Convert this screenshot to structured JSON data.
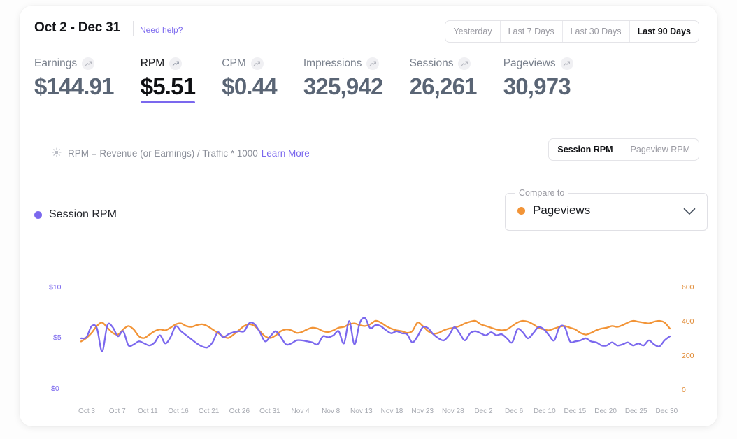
{
  "header": {
    "date_range": "Oct 2 - Dec 31",
    "need_help": "Need help?",
    "range_buttons": [
      {
        "label": "Yesterday",
        "active": false
      },
      {
        "label": "Last 7 Days",
        "active": false
      },
      {
        "label": "Last 30 Days",
        "active": false
      },
      {
        "label": "Last 90 Days",
        "active": true
      }
    ]
  },
  "metrics": [
    {
      "label": "Earnings",
      "value": "$144.91",
      "active": false,
      "icon": "trend-up-icon"
    },
    {
      "label": "RPM",
      "value": "$5.51",
      "active": true,
      "icon": "trend-up-icon"
    },
    {
      "label": "CPM",
      "value": "$0.44",
      "active": false,
      "icon": "trend-up-icon"
    },
    {
      "label": "Impressions",
      "value": "325,942",
      "active": false,
      "icon": "trend-up-icon"
    },
    {
      "label": "Sessions",
      "value": "26,261",
      "active": false,
      "icon": "trend-up-icon"
    },
    {
      "label": "Pageviews",
      "value": "30,973",
      "active": false,
      "icon": "trend-up-icon"
    }
  ],
  "formula": {
    "icon": "lightbulb-icon",
    "text": "RPM = Revenue (or Earnings) / Traffic * 1000",
    "learn_more": "Learn More"
  },
  "rpm_toggle": [
    {
      "label": "Session RPM",
      "active": true
    },
    {
      "label": "Pageview RPM",
      "active": false
    }
  ],
  "legend": {
    "primary_label": "Session RPM",
    "primary_color": "#7b68ee"
  },
  "compare": {
    "legend_label": "Compare to",
    "selected": "Pageviews",
    "selected_color": "#f29437",
    "chevron": "chevron-down-icon"
  },
  "chart_data": {
    "type": "line",
    "title": "",
    "xlabel": "",
    "grid": false,
    "legend_position": "top-left",
    "x_tick_labels": [
      "Oct 3",
      "Oct 7",
      "Oct 11",
      "Oct 16",
      "Oct 21",
      "Oct 26",
      "Oct 31",
      "Nov 4",
      "Nov 8",
      "Nov 13",
      "Nov 18",
      "Nov 23",
      "Nov 28",
      "Dec 2",
      "Dec 6",
      "Dec 10",
      "Dec 15",
      "Dec 20",
      "Dec 25",
      "Dec 30"
    ],
    "y_left": {
      "label": "Session RPM",
      "color": "#7b68ee",
      "ticks": [
        "$10",
        "$5",
        "$0"
      ],
      "tick_values": [
        10,
        5,
        0
      ],
      "ylim": [
        0,
        11.4
      ]
    },
    "y_right": {
      "label": "Pageviews",
      "color": "#e08a34",
      "ticks": [
        "600",
        "400",
        "200",
        "0"
      ],
      "tick_values": [
        600,
        400,
        200,
        0
      ],
      "ylim": [
        0,
        684
      ]
    },
    "series": [
      {
        "name": "Session RPM",
        "color": "#7b68ee",
        "axis": "left",
        "unit": "$",
        "values": [
          4.9,
          5.0,
          6.1,
          5.9,
          3.6,
          6.2,
          6.0,
          5.1,
          5.6,
          4.2,
          4.3,
          4.6,
          4.4,
          4.2,
          4.5,
          5.2,
          4.4,
          5.0,
          6.1,
          5.6,
          5.2,
          4.8,
          4.4,
          4.1,
          4.0,
          4.5,
          5.5,
          5.0,
          5.3,
          5.5,
          5.6,
          5.6,
          6.4,
          6.3,
          5.5,
          4.6,
          5.1,
          5.6,
          5.0,
          4.3,
          4.4,
          4.7,
          4.7,
          4.6,
          4.5,
          4.3,
          5.1,
          5.0,
          5.2,
          5.6,
          4.4,
          6.6,
          4.3,
          6.4,
          6.9,
          5.9,
          6.2,
          6.1,
          5.7,
          5.4,
          5.6,
          5.4,
          5.3,
          4.5,
          5.1,
          6.0,
          5.9,
          5.3,
          4.9,
          4.7,
          5.2,
          6.0,
          5.4,
          4.7,
          5.4,
          5.6,
          5.4,
          5.2,
          5.5,
          5.2,
          5.3,
          4.9,
          4.5,
          5.8,
          5.5,
          4.9,
          5.4,
          6.0,
          5.8,
          5.2,
          4.7,
          6.0,
          6.0,
          4.6,
          4.6,
          4.7,
          4.9,
          4.6,
          4.5,
          4.2,
          4.2,
          4.5,
          4.2,
          4.3,
          4.5,
          4.2,
          4.4,
          4.2,
          4.7,
          4.3,
          4.1,
          4.7,
          5.1
        ],
        "points": 113
      },
      {
        "name": "Pageviews",
        "color": "#f29437",
        "axis": "right",
        "values": [
          280,
          300,
          330,
          370,
          390,
          360,
          330,
          320,
          350,
          370,
          350,
          310,
          300,
          320,
          340,
          350,
          345,
          360,
          380,
          385,
          370,
          365,
          375,
          380,
          370,
          350,
          330,
          310,
          300,
          320,
          345,
          370,
          380,
          370,
          340,
          310,
          300,
          315,
          340,
          350,
          345,
          330,
          335,
          350,
          360,
          355,
          340,
          335,
          345,
          360,
          365,
          380,
          385,
          375,
          370,
          380,
          400,
          390,
          370,
          355,
          345,
          340,
          330,
          340,
          390,
          370,
          340,
          325,
          330,
          345,
          355,
          360,
          370,
          385,
          395,
          400,
          380,
          370,
          360,
          350,
          345,
          350,
          370,
          390,
          400,
          395,
          380,
          360,
          350,
          345,
          355,
          365,
          370,
          360,
          350,
          330,
          320,
          330,
          345,
          355,
          360,
          370,
          365,
          375,
          390,
          400,
          395,
          390,
          385,
          395,
          400,
          390,
          355
        ],
        "points": 113
      }
    ]
  }
}
